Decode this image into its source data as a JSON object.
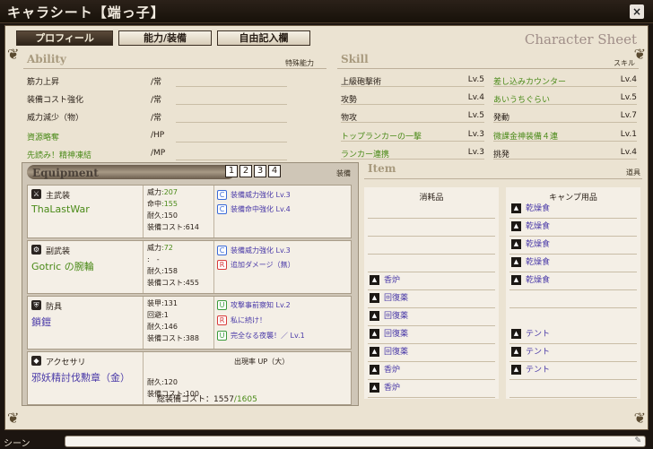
{
  "window": {
    "title": "キャラシート【端っ子】",
    "close_glyph": "×"
  },
  "tabs": [
    {
      "label": "プロフィール",
      "active": true
    },
    {
      "label": "能力/装備",
      "active": false
    },
    {
      "label": "自由記入欄",
      "active": false
    }
  ],
  "sheet_title": "Character Sheet",
  "ability": {
    "title": "Ability",
    "subtitle": "特殊能力",
    "rows": [
      {
        "name": "筋力上昇",
        "unit": "/常",
        "green": false
      },
      {
        "name": "装備コスト強化",
        "unit": "/常",
        "green": false
      },
      {
        "name": "威力減少（物）",
        "unit": "/常",
        "green": false
      },
      {
        "name": "資源略奪",
        "unit": "/HP",
        "green": true
      },
      {
        "name": "先読み！精神凍結",
        "unit": "/MP",
        "green": true
      }
    ]
  },
  "skill": {
    "title": "Skill",
    "subtitle": "スキル",
    "left": [
      {
        "name": "上級砲撃術",
        "lv": "Lv.5",
        "green": false
      },
      {
        "name": "攻勢",
        "lv": "Lv.4",
        "green": false
      },
      {
        "name": "物攻",
        "lv": "Lv.5",
        "green": false
      },
      {
        "name": "トップランカーの一撃",
        "lv": "Lv.3",
        "green": true
      },
      {
        "name": "ランカー連携",
        "lv": "Lv.3",
        "green": true
      }
    ],
    "right": [
      {
        "name": "差し込みカウンター",
        "lv": "Lv.4",
        "green": true
      },
      {
        "name": "あいうちぐらい",
        "lv": "Lv.5",
        "green": true
      },
      {
        "name": "発動",
        "lv": "Lv.7",
        "green": false
      },
      {
        "name": "微課金神装備４連",
        "lv": "Lv.1",
        "green": true
      },
      {
        "name": "挑発",
        "lv": "Lv.4",
        "green": false
      }
    ]
  },
  "equipment": {
    "title": "Equipment",
    "subtitle": "装備",
    "page_numbers": [
      "1",
      "2",
      "3",
      "4"
    ],
    "cards": [
      {
        "icon": "⚔",
        "slot": "主武装",
        "name": "ThaLastWar",
        "name_color": "green",
        "stats": [
          [
            "威力",
            ":207",
            true
          ],
          [
            "命中",
            ":155",
            true
          ],
          [
            "耐久",
            ":150",
            false
          ],
          [
            "装備コスト",
            ":614",
            false
          ]
        ],
        "abilities": [
          [
            "C",
            "装備威力強化 Lv.3"
          ],
          [
            "C",
            "装備命中強化 Lv.4"
          ]
        ]
      },
      {
        "icon": "⚙",
        "slot": "副武装",
        "name": "Gotric の腕輪",
        "name_color": "green",
        "stats": [
          [
            "威力",
            ":72",
            true
          ],
          [
            "",
            ":　-",
            false
          ],
          [
            "耐久",
            ":158",
            false
          ],
          [
            "装備コスト",
            ":455",
            false
          ]
        ],
        "abilities": [
          [
            "C",
            "装備威力強化 Lv.3"
          ],
          [
            "R",
            "追加ダメージ（無）"
          ]
        ]
      },
      {
        "icon": "⛨",
        "slot": "防具",
        "name": "鎖鎧",
        "name_color": "blue",
        "stats": [
          [
            "装甲",
            ":131",
            false
          ],
          [
            "回避",
            ":1",
            false
          ],
          [
            "耐久",
            ":146",
            false
          ],
          [
            "装備コスト",
            ":388",
            false
          ]
        ],
        "abilities": [
          [
            "U",
            "攻撃事前察知 Lv.2"
          ],
          [
            "R",
            "私に続け！"
          ],
          [
            "U",
            "完全なる夜襲！／ Lv.1"
          ]
        ]
      },
      {
        "icon": "◆",
        "slot": "アクセサリ",
        "name": "邪妖精討伐勲章（金）",
        "name_color": "blue",
        "stats": [
          [
            "",
            "",
            false
          ],
          [
            "",
            "",
            false
          ],
          [
            "耐久",
            ":120",
            false
          ],
          [
            "装備コスト",
            ":100",
            false
          ]
        ],
        "drop": "出現率 UP（大）"
      }
    ],
    "total_label": "総装備コスト：",
    "total_used": "1557",
    "total_max": "/1605"
  },
  "item": {
    "title": "Item",
    "subtitle": "道具",
    "consumables_title": "消耗品",
    "camp_title": "キャンプ用品",
    "consumables": [
      "",
      "",
      "",
      "",
      "香炉",
      "回復薬",
      "回復薬",
      "回復薬",
      "回復薬",
      "香炉",
      "香炉"
    ],
    "camp": [
      "乾燥食",
      "乾燥食",
      "乾燥食",
      "乾燥食",
      "乾燥食",
      "",
      "テント",
      "テント",
      "テント"
    ]
  },
  "command_bar": {
    "label": "シーン",
    "placeholder": ""
  }
}
